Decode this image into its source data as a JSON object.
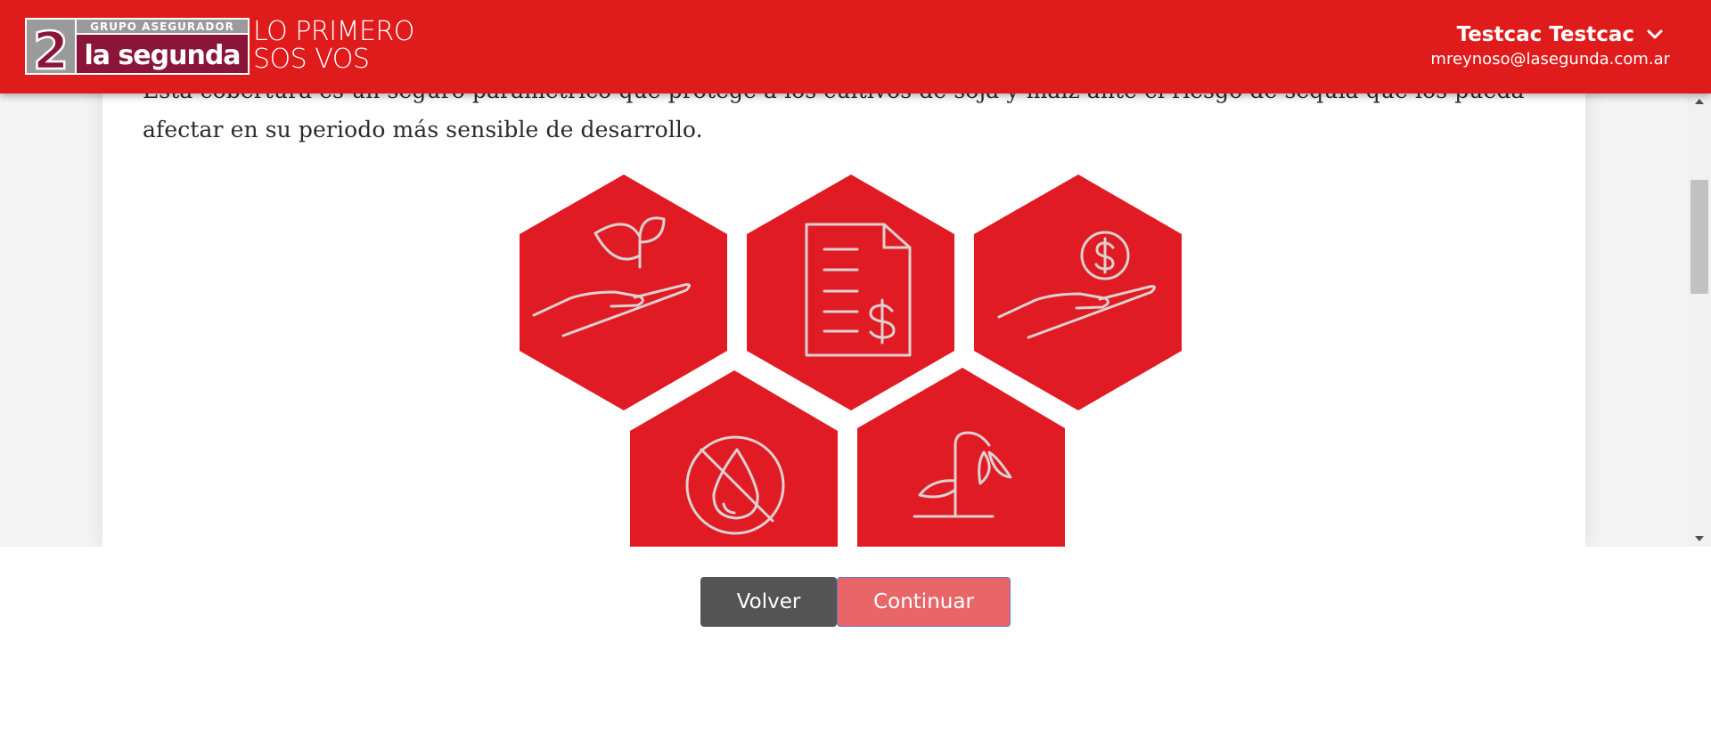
{
  "header": {
    "brand": {
      "logo_number": "2",
      "group_text": "GRUPO ASEGURADOR",
      "name": "la segunda"
    },
    "slogan_line1": "LO PRIMERO",
    "slogan_line2": "SOS VOS",
    "user": {
      "name": "Testcac Testcac",
      "email": "mreynoso@lasegunda.com.ar",
      "menu_icon": "chevron-down-icon"
    }
  },
  "content": {
    "description": "Esta cobertura es un seguro paramétrico que protege a los cultivos de soja y maíz ante el riesgo de sequía que los pueda afectar en su periodo más sensible de desarrollo.",
    "illustration_icons": [
      "plant-in-hand-icon",
      "invoice-dollar-icon",
      "coin-in-hand-icon",
      "no-water-drop-icon",
      "wilted-plant-icon"
    ]
  },
  "actions": {
    "back_label": "Volver",
    "continue_label": "Continuar"
  },
  "colors": {
    "brand_red": "#e01b1c",
    "logo_maroon": "#8a1538",
    "logo_gray": "#9a9a9a",
    "button_dark": "#545454",
    "button_continue": "#e86668",
    "icon_line": "#e0d0d0"
  }
}
